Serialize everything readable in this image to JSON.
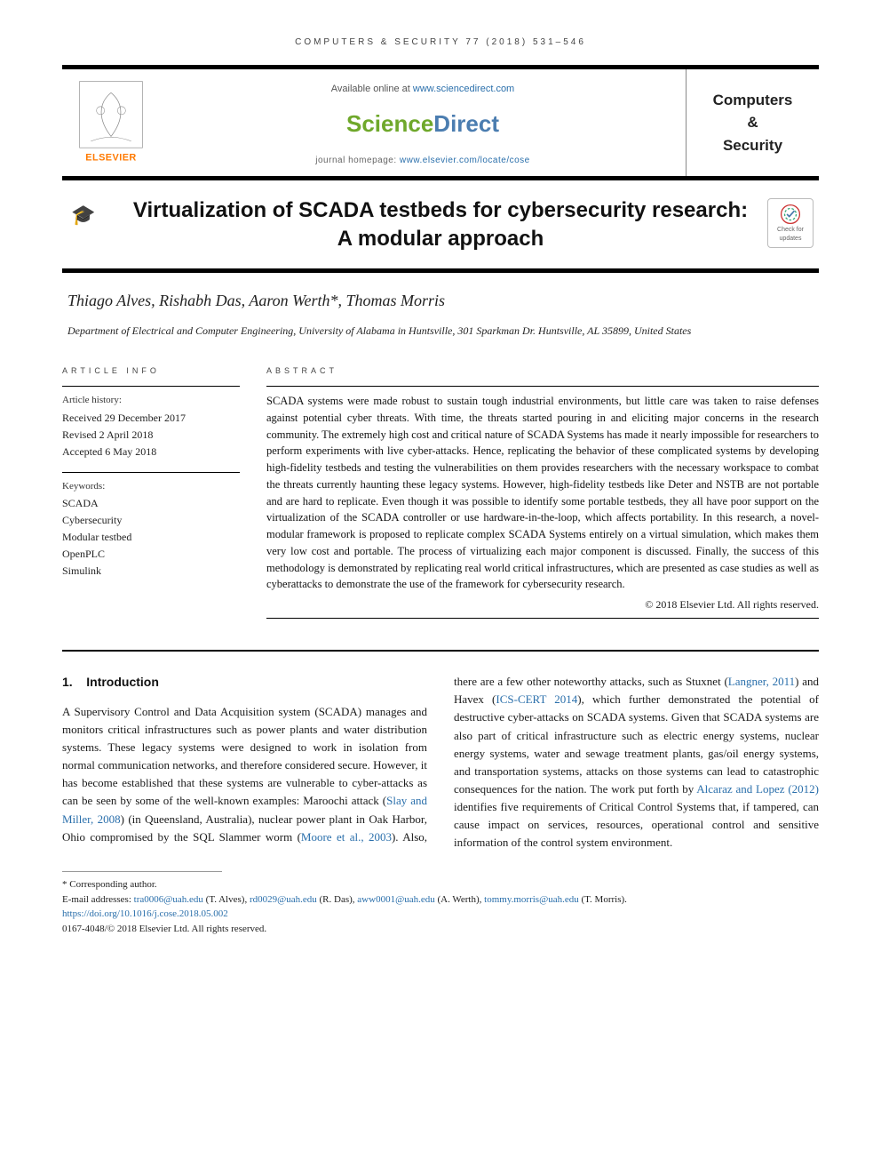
{
  "running_header": {
    "prefix": "COMPUTERS & SECURITY 77 (2018) 531–546"
  },
  "header": {
    "available_text": "Available online at ",
    "available_url": "www.sciencedirect.com",
    "sd_prefix": "Science",
    "sd_suffix": "Direct",
    "homepage_prefix": "journal homepage: ",
    "homepage_url": "www.elsevier.com/locate/cose",
    "journal_name": "Computers\n&\nSecurity",
    "elsevier_label": "ELSEVIER"
  },
  "title": "Virtualization of SCADA testbeds for cybersecurity research: A modular approach",
  "crossmark": {
    "line1": "Check for",
    "line2": "updates"
  },
  "authors": "Thiago Alves, Rishabh Das, Aaron Werth*, Thomas Morris",
  "affiliation": "Department of Electrical and Computer Engineering, University of Alabama in Huntsville, 301 Sparkman Dr. Huntsville, AL 35899, United States",
  "article_info": {
    "heading": "ARTICLE INFO",
    "history_label": "Article history:",
    "received": "Received 29 December 2017",
    "revised": "Revised 2 April 2018",
    "accepted": "Accepted 6 May 2018",
    "keywords_label": "Keywords:",
    "keywords": [
      "SCADA",
      "Cybersecurity",
      "Modular testbed",
      "OpenPLC",
      "Simulink"
    ]
  },
  "abstract": {
    "heading": "ABSTRACT",
    "text": "SCADA systems were made robust to sustain tough industrial environments, but little care was taken to raise defenses against potential cyber threats. With time, the threats started pouring in and eliciting major concerns in the research community. The extremely high cost and critical nature of SCADA Systems has made it nearly impossible for researchers to perform experiments with live cyber-attacks. Hence, replicating the behavior of these complicated systems by developing high-fidelity testbeds and testing the vulnerabilities on them provides researchers with the necessary workspace to combat the threats currently haunting these legacy systems. However, high-fidelity testbeds like Deter and NSTB are not portable and are hard to replicate. Even though it was possible to identify some portable testbeds, they all have poor support on the virtualization of the SCADA controller or use hardware-in-the-loop, which affects portability. In this research, a novel-modular framework is proposed to replicate complex SCADA Systems entirely on a virtual simulation, which makes them very low cost and portable. The process of virtualizing each major component is discussed. Finally, the success of this methodology is demonstrated by replicating real world critical infrastructures, which are presented as case studies as well as cyberattacks to demonstrate the use of the framework for cybersecurity research.",
    "copyright": "© 2018 Elsevier Ltd. All rights reserved."
  },
  "section": {
    "number": "1.",
    "title": "Introduction"
  },
  "body": {
    "p1a": "A Supervisory Control and Data Acquisition system (SCADA) manages and monitors critical infrastructures such as power plants and water distribution systems. These legacy systems were designed to work in isolation from normal communication networks, and therefore considered secure. However, it has become established that these systems are vulnerable to cyber-attacks as can be seen by some of the well-known examples: Maroochi attack (",
    "cite1": "Slay and Miller, 2008",
    "p1b": ") (in Queensland, Australia), nuclear power plant in Oak Harbor, Ohio compromised by the SQL Slammer worm (",
    "cite2": "Moore et al., 2003",
    "p1c": "). Also, there are a few other noteworthy attacks, such as Stuxnet (",
    "cite3": "Langner, 2011",
    "p1d": ") and Havex (",
    "cite4": "ICS-CERT 2014",
    "p1e": "), which further demonstrated the potential of destructive cyber-attacks on SCADA systems. Given that SCADA systems are also part of critical infrastructure such as electric energy systems, nuclear energy systems, water and sewage treatment plants, gas/oil energy systems, and transportation systems, attacks on those systems can lead to catastrophic consequences for the nation. The work put forth by ",
    "cite5": "Alcaraz and Lopez (2012)",
    "p1f": " identifies five requirements of Critical Control Systems that, if tampered, can cause impact on services, resources, operational control and sensitive information of the control system environment."
  },
  "footnotes": {
    "corresponding": "* Corresponding author.",
    "email_prefix": "E-mail addresses: ",
    "emails": [
      {
        "addr": "tra0006@uah.edu",
        "name": "(T. Alves)"
      },
      {
        "addr": "rd0029@uah.edu",
        "name": "(R. Das)"
      },
      {
        "addr": "aww0001@uah.edu",
        "name": "(A. Werth)"
      },
      {
        "addr": "tommy.morris@uah.edu",
        "name": "(T. Morris)"
      }
    ],
    "doi": "https://doi.org/10.1016/j.cose.2018.05.002",
    "issn_line": "0167-4048/© 2018 Elsevier Ltd. All rights reserved."
  }
}
